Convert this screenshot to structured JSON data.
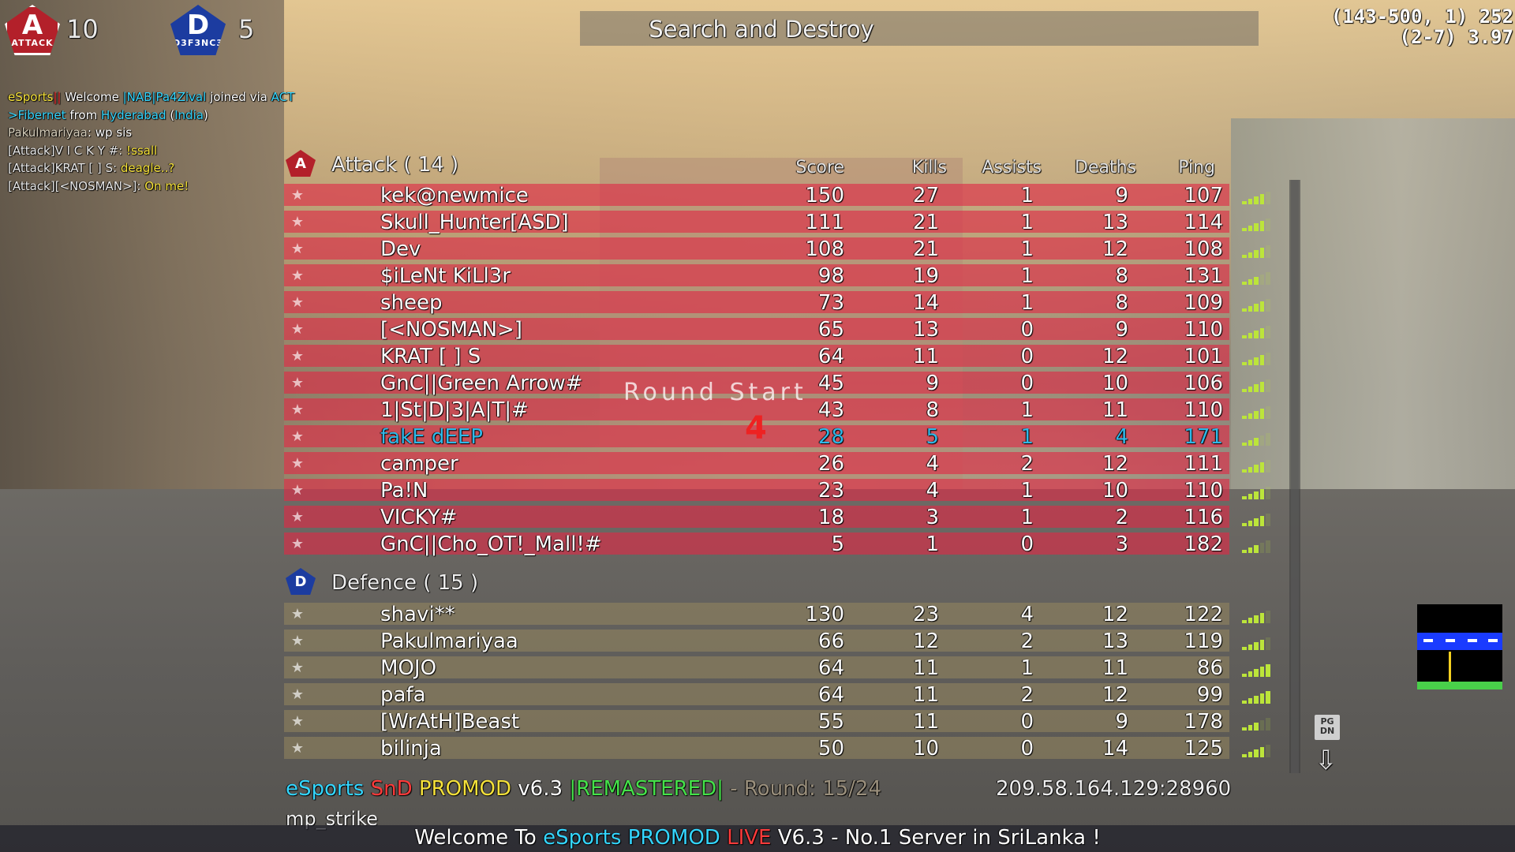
{
  "top": {
    "mode_title": "Search and Destroy",
    "attack_emblem_letter": "A",
    "attack_emblem_word": "ATTACK",
    "attack_alive": "10",
    "defence_emblem_letter": "D",
    "defence_emblem_word": "D3F3NC3",
    "defence_alive": "5",
    "coords_line1": "(143-500, 1) 252",
    "coords_line2": "(2-7) 3.97"
  },
  "chat": [
    {
      "parts": [
        {
          "t": "eSports",
          "c": "#f6e23a"
        },
        {
          "t": "|| ",
          "c": "#ff3b3b"
        },
        {
          "t": "Welcome ",
          "c": "#ffffff"
        },
        {
          "t": "|NAB|Pa4Zival",
          "c": "#34d6ff"
        },
        {
          "t": " joined via ",
          "c": "#ffffff"
        },
        {
          "t": "ACT",
          "c": "#34d6ff"
        }
      ]
    },
    {
      "parts": [
        {
          "t": ">Fibernet",
          "c": "#34d6ff"
        },
        {
          "t": " from ",
          "c": "#ffffff"
        },
        {
          "t": "Hyderabad",
          "c": "#34d6ff"
        },
        {
          "t": " (",
          "c": "#ffffff"
        },
        {
          "t": "India",
          "c": "#34d6ff"
        },
        {
          "t": ")",
          "c": "#ffffff"
        }
      ]
    },
    {
      "parts": [
        {
          "t": "Pakulmariyaa",
          "c": "#d8d0bd"
        },
        {
          "t": ": wp sis",
          "c": "#ffffff"
        }
      ]
    },
    {
      "parts": [
        {
          "t": "[Attack]V I C K Y #: ",
          "c": "#e8e8e8"
        },
        {
          "t": "!ssall",
          "c": "#f6e23a"
        }
      ]
    },
    {
      "parts": [
        {
          "t": "[Attack]KRAT [ ] S: ",
          "c": "#e8e8e8"
        },
        {
          "t": "deagle..?",
          "c": "#f6e23a"
        }
      ]
    },
    {
      "parts": [
        {
          "t": "[Attack][<NOSMAN>]: ",
          "c": "#e8e8e8"
        },
        {
          "t": "On me!",
          "c": "#f6e23a"
        }
      ]
    }
  ],
  "columns": {
    "score": "Score",
    "kills": "Kills",
    "assists": "Assists",
    "deaths": "Deaths",
    "ping": "Ping"
  },
  "attack": {
    "icon_letter": "A",
    "label": "Attack ( 14 )",
    "players": [
      {
        "name": "kek@newmice",
        "score": "150",
        "kills": "27",
        "assists": "1",
        "deaths": "9",
        "ping": "107",
        "sig": 4
      },
      {
        "name": "Skull_Hunter[ASD]",
        "score": "111",
        "kills": "21",
        "assists": "1",
        "deaths": "13",
        "ping": "114",
        "sig": 4
      },
      {
        "name": "Dev",
        "score": "108",
        "kills": "21",
        "assists": "1",
        "deaths": "12",
        "ping": "108",
        "sig": 4
      },
      {
        "name": "$iLeNt KiLl3r",
        "score": "98",
        "kills": "19",
        "assists": "1",
        "deaths": "8",
        "ping": "131",
        "sig": 3
      },
      {
        "name": "sheep",
        "score": "73",
        "kills": "14",
        "assists": "1",
        "deaths": "8",
        "ping": "109",
        "sig": 4
      },
      {
        "name": "[<NOSMAN>]",
        "score": "65",
        "kills": "13",
        "assists": "0",
        "deaths": "9",
        "ping": "110",
        "sig": 4
      },
      {
        "name": "KRAT [ ] S",
        "score": "64",
        "kills": "11",
        "assists": "0",
        "deaths": "12",
        "ping": "101",
        "sig": 4
      },
      {
        "name": "GnC||Green Arrow#",
        "score": "45",
        "kills": "9",
        "assists": "0",
        "deaths": "10",
        "ping": "106",
        "sig": 4
      },
      {
        "name": "1|St|D|3|A|T|#",
        "score": "43",
        "kills": "8",
        "assists": "1",
        "deaths": "11",
        "ping": "110",
        "sig": 4
      },
      {
        "name": "fakE dEEP",
        "score": "28",
        "kills": "5",
        "assists": "1",
        "deaths": "4",
        "ping": "171",
        "sig": 3,
        "highlight": true
      },
      {
        "name": "camper",
        "score": "26",
        "kills": "4",
        "assists": "2",
        "deaths": "12",
        "ping": "111",
        "sig": 4
      },
      {
        "name": "Pa!N",
        "score": "23",
        "kills": "4",
        "assists": "1",
        "deaths": "10",
        "ping": "110",
        "sig": 4
      },
      {
        "name": "VICKY#",
        "score": "18",
        "kills": "3",
        "assists": "1",
        "deaths": "2",
        "ping": "116",
        "sig": 4
      },
      {
        "name": "GnC||Cho_OT!_Mall!#",
        "score": "5",
        "kills": "1",
        "assists": "0",
        "deaths": "3",
        "ping": "182",
        "sig": 3
      }
    ]
  },
  "defence": {
    "icon_letter": "D",
    "label": "Defence ( 15 )",
    "players": [
      {
        "name": "shavi**",
        "score": "130",
        "kills": "23",
        "assists": "4",
        "deaths": "12",
        "ping": "122",
        "sig": 4
      },
      {
        "name": "Pakulmariyaa",
        "score": "66",
        "kills": "12",
        "assists": "2",
        "deaths": "13",
        "ping": "119",
        "sig": 4
      },
      {
        "name": "MOJO",
        "score": "64",
        "kills": "11",
        "assists": "1",
        "deaths": "11",
        "ping": "86",
        "sig": 5
      },
      {
        "name": "pafa",
        "score": "64",
        "kills": "11",
        "assists": "2",
        "deaths": "12",
        "ping": "99",
        "sig": 5
      },
      {
        "name": "[WrAtH]Beast",
        "score": "55",
        "kills": "11",
        "assists": "0",
        "deaths": "9",
        "ping": "178",
        "sig": 3
      },
      {
        "name": "bilinja",
        "score": "50",
        "kills": "10",
        "assists": "0",
        "deaths": "14",
        "ping": "125",
        "sig": 4
      }
    ]
  },
  "overlay": {
    "round_start": "Round Start",
    "countdown": "4"
  },
  "footer": {
    "esports": "eSports",
    "snd": "SnD",
    "promod": "PROMOD",
    "version": "v6.3",
    "remastered": "|REMASTERED|",
    "round": "- Round: 15/24",
    "ip": "209.58.164.129:28960",
    "map": "mp_strike",
    "banner_prefix": "Welcome To ",
    "banner_esports": "eSports PROMOD ",
    "banner_live": "LIVE",
    "banner_suffix": " V6.3 - No.1 Server in SriLanka !",
    "pgdn": "PG DN"
  },
  "colors": {
    "attack_row": "#e12846",
    "defence_row": "#96875f",
    "highlight": "#2fb8e8",
    "signal": "#bce53a"
  }
}
